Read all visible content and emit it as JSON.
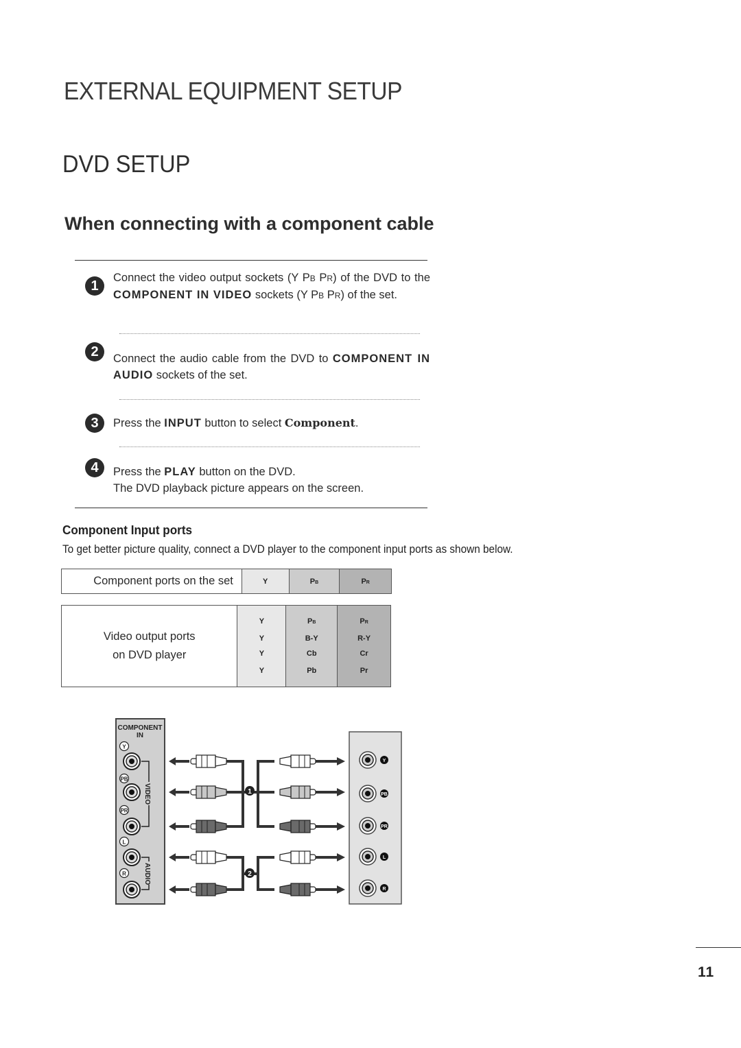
{
  "header": {
    "section_title": "EXTERNAL EQUIPMENT SETUP",
    "page_title": "DVD SETUP",
    "subtitle": "When connecting with a component cable"
  },
  "steps": [
    {
      "number": "1",
      "parts": [
        {
          "t": "Connect the video output sockets (Y P",
          "s": "n"
        },
        {
          "t": "B",
          "s": "sc"
        },
        {
          "t": " P",
          "s": "n"
        },
        {
          "t": "R",
          "s": "sc"
        },
        {
          "t": ") of the DVD to the ",
          "s": "n"
        },
        {
          "t": "COMPONENT IN VIDEO",
          "s": "b"
        },
        {
          "t": " sockets (Y P",
          "s": "n"
        },
        {
          "t": "B",
          "s": "sc"
        },
        {
          "t": " P",
          "s": "n"
        },
        {
          "t": "R",
          "s": "sc"
        },
        {
          "t": ") of the set.",
          "s": "n"
        }
      ]
    },
    {
      "number": "2",
      "parts": [
        {
          "t": "Connect the audio cable from the DVD to ",
          "s": "n"
        },
        {
          "t": "COMPONENT IN AUDIO",
          "s": "b"
        },
        {
          "t": " sockets of the set.",
          "s": "n"
        }
      ]
    },
    {
      "number": "3",
      "parts": [
        {
          "t": "Press the ",
          "s": "n"
        },
        {
          "t": "INPUT",
          "s": "b"
        },
        {
          "t": " button to select ",
          "s": "n"
        },
        {
          "t": "Component",
          "s": "serif"
        },
        {
          "t": ".",
          "s": "n"
        }
      ]
    },
    {
      "number": "4",
      "parts": [
        {
          "t": "Press the ",
          "s": "n"
        },
        {
          "t": "PLAY",
          "s": "b"
        },
        {
          "t": " button on the DVD.",
          "s": "n"
        },
        {
          "t": "\n",
          "s": "br"
        },
        {
          "t": "The DVD playback picture appears on the screen.",
          "s": "n"
        }
      ]
    }
  ],
  "component_ports": {
    "heading": "Component Input ports",
    "description": "To get better picture quality, connect a DVD player to the component input ports as shown below.",
    "set_row": {
      "label": "Component ports on the set",
      "y": "Y",
      "pb": "P",
      "pb_sub": "B",
      "pr": "P",
      "pr_sub": "R"
    },
    "dvd_table": {
      "label_line1": "Video output ports",
      "label_line2": "on DVD player",
      "rows": [
        {
          "y": "Y",
          "pb": "P",
          "pb_sub": "B",
          "pr": "P",
          "pr_sub": "R"
        },
        {
          "y": "Y",
          "pb": "B-Y",
          "pb_sub": "",
          "pr": "R-Y",
          "pr_sub": ""
        },
        {
          "y": "Y",
          "pb": "Cb",
          "pb_sub": "",
          "pr": "Cr",
          "pr_sub": ""
        },
        {
          "y": "Y",
          "pb": "Pb",
          "pb_sub": "",
          "pr": "Pr",
          "pr_sub": ""
        }
      ]
    }
  },
  "diagram": {
    "tv_panel_title_line1": "COMPONENT",
    "tv_panel_title_line2": "IN",
    "tv_jack_labels": [
      "Y",
      "PB",
      "PR",
      "L",
      "R"
    ],
    "video_group_label": "VIDEO",
    "audio_group_label": "AUDIO",
    "cable_markers": [
      "1",
      "2"
    ],
    "dvd_jack_labels": [
      "Y",
      "PB",
      "PR",
      "L",
      "R"
    ],
    "colors": {
      "panel": "#d0d0d0",
      "plug_white": "#ffffff",
      "plug_light": "#c8c8c8",
      "plug_dark": "#6a6a6a",
      "cable": "#333333"
    }
  },
  "footer": {
    "page_number": "11"
  }
}
